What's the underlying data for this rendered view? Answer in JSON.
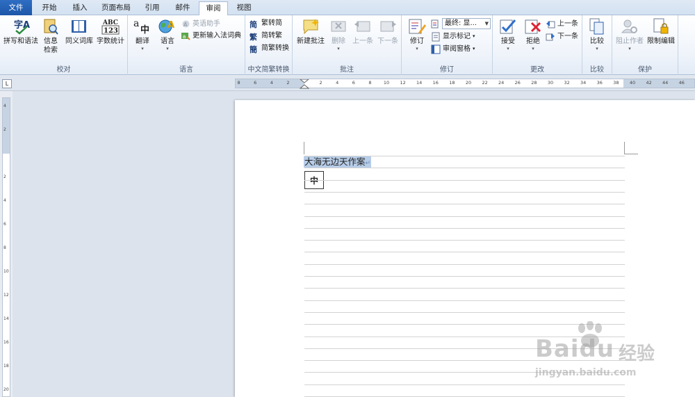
{
  "tabs": [
    {
      "label": "文件",
      "active": false,
      "file": true
    },
    {
      "label": "开始",
      "active": false
    },
    {
      "label": "插入",
      "active": false
    },
    {
      "label": "页面布局",
      "active": false
    },
    {
      "label": "引用",
      "active": false
    },
    {
      "label": "邮件",
      "active": false
    },
    {
      "label": "审阅",
      "active": true
    },
    {
      "label": "视图",
      "active": false
    }
  ],
  "ribbon": {
    "proofing": {
      "label": "校对",
      "spelling": "拼写和语法",
      "research_line1": "信息",
      "research_line2": "检索",
      "thesaurus": "同义词库",
      "word_count": "字数统计"
    },
    "language": {
      "label": "语言",
      "translate": "翻译",
      "language": "语言",
      "english_assistant": "英语助手",
      "update_ime": "更新输入法词典"
    },
    "chinese_conversion": {
      "label": "中文简繁转换",
      "trad_to_simp": "繁转简",
      "simp_to_trad": "简转繁",
      "convert": "简繁转换"
    },
    "comments": {
      "label": "批注",
      "new_comment": "新建批注",
      "delete": "删除",
      "previous": "上一条",
      "next": "下一条"
    },
    "tracking": {
      "label": "修订",
      "track_changes": "修订",
      "display_select": "最终: 显...",
      "show_markup": "显示标记",
      "reviewing_pane": "审阅窗格"
    },
    "changes": {
      "label": "更改",
      "accept": "接受",
      "reject": "拒绝",
      "previous": "上一条",
      "next": "下一条"
    },
    "compare": {
      "label": "比较",
      "compare": "比较"
    },
    "protect": {
      "label": "保护",
      "block_authors": "阻止作者",
      "restrict_editing": "限制编辑"
    }
  },
  "ruler": {
    "corner_glyph": "L",
    "h_ticks": [
      "8",
      "6",
      "4",
      "2",
      "2",
      "4",
      "6",
      "8",
      "10",
      "12",
      "14",
      "16",
      "18",
      "20",
      "22",
      "24",
      "26",
      "28",
      "30",
      "32",
      "34",
      "36",
      "38",
      "40",
      "42",
      "44",
      "46"
    ],
    "v_ticks": [
      "4",
      "2",
      "2",
      "4",
      "6",
      "8",
      "10",
      "12",
      "14",
      "16",
      "18",
      "20",
      "22"
    ]
  },
  "document": {
    "selected_text": "大海无边天作案",
    "paragraph_mark": "↵",
    "ime_indicator": "中"
  },
  "watermark": {
    "main": "Bai",
    "paw": "du",
    "cn": "经验",
    "url": "jingyan.baidu.com"
  }
}
